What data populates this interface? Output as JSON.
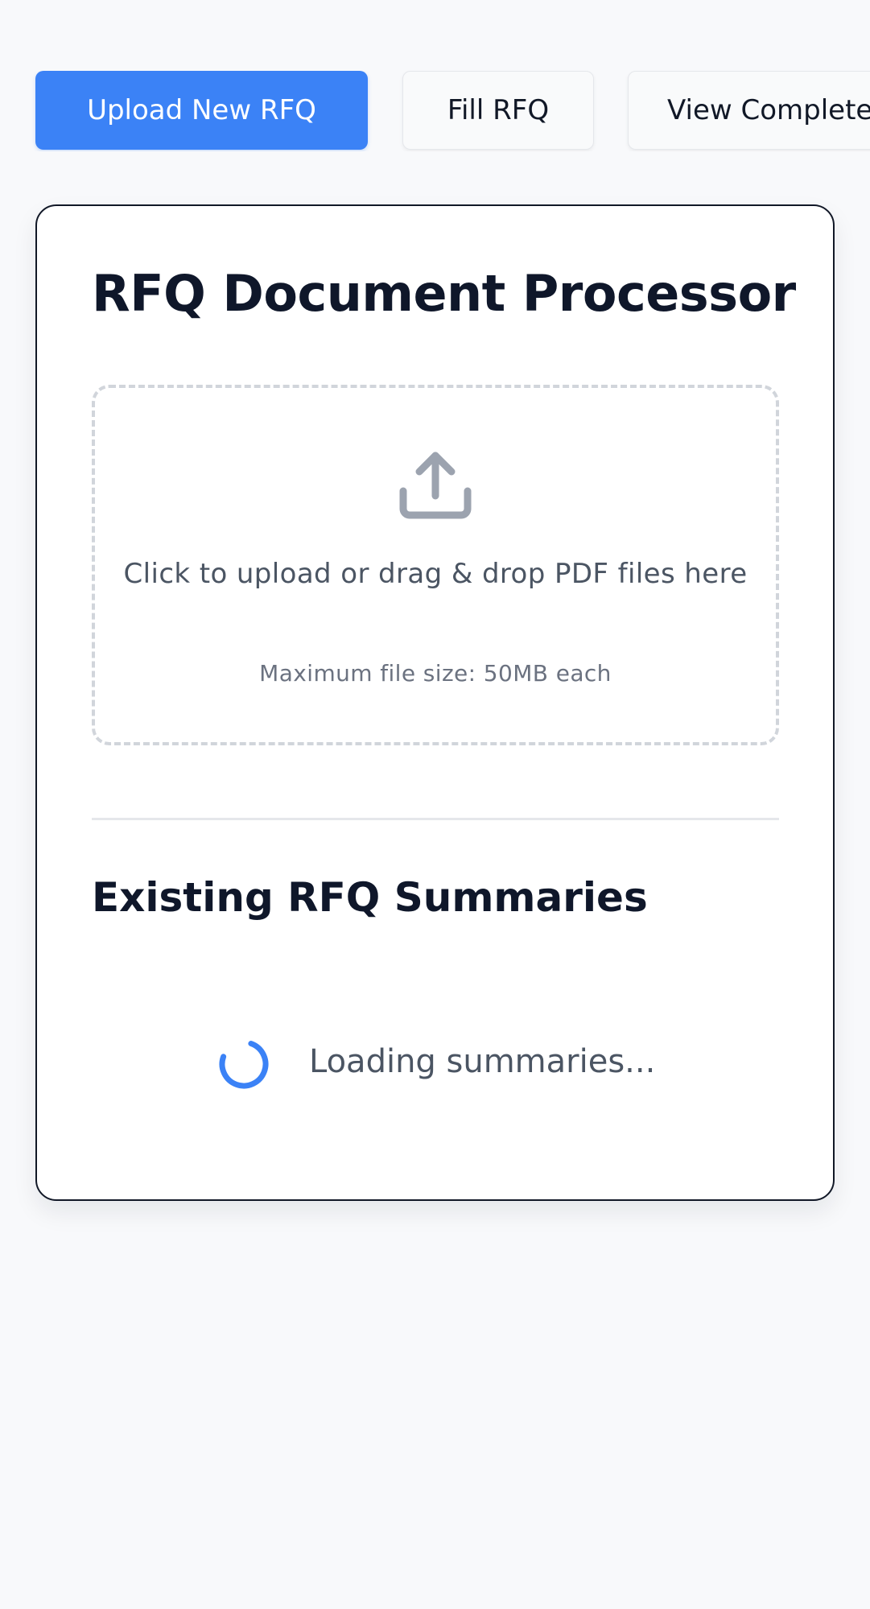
{
  "tabs": [
    {
      "label": "Upload New RFQ",
      "active": true
    },
    {
      "label": "Fill RFQ",
      "active": false
    },
    {
      "label": "View Completed RFQs",
      "active": false
    }
  ],
  "card": {
    "title": "RFQ Document Processor",
    "dropzone": {
      "icon": "upload-icon",
      "text": "Click to upload or drag & drop PDF files here",
      "subtext": "Maximum file size: 50MB each"
    },
    "summaries": {
      "heading": "Existing RFQ Summaries",
      "loading_text": "Loading summaries..."
    }
  },
  "colors": {
    "accent": "#3b82f6",
    "background": "#f8f9fb",
    "card_border": "#111827",
    "dropzone_border": "#d1d5db",
    "icon_gray": "#9ca3af"
  }
}
